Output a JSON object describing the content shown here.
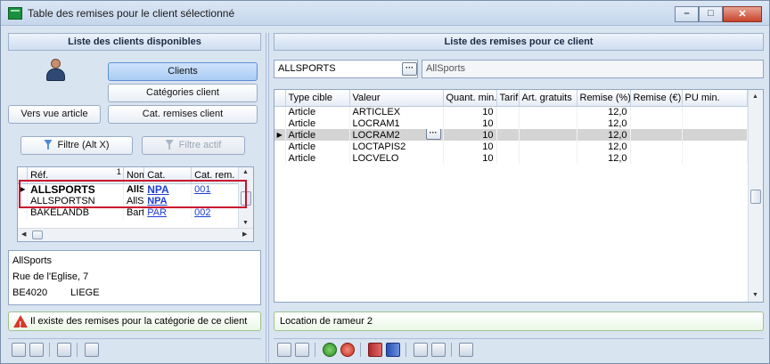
{
  "window": {
    "title": "Table des remises pour le client sélectionné",
    "minimize": "–",
    "maximize": "□",
    "close": "✕"
  },
  "left": {
    "header": "Liste des clients disponibles",
    "buttons": {
      "clients": "Clients",
      "categories": "Catégories client",
      "vers_vue": "Vers vue article",
      "cat_remises": "Cat. remises client",
      "filtre": "Filtre (Alt X)",
      "filtre_actif": "Filtre actif"
    },
    "grid": {
      "columns": [
        "Réf.",
        "Nom",
        "Cat.",
        "Cat. rem."
      ],
      "sort_mark": "1",
      "rows": [
        {
          "ref": "ALLSPORTS",
          "nom": "AllSp",
          "cat": "NPA",
          "catrem": "001",
          "selected": true
        },
        {
          "ref": "ALLSPORTSN",
          "nom": "AllSp",
          "cat": "NPA",
          "catrem": "",
          "selected": false
        },
        {
          "ref": "BAKELANDB",
          "nom": "Bart I",
          "cat": "PAR",
          "catrem": "002",
          "selected": false
        }
      ]
    },
    "address": {
      "name": "AllSports",
      "street": "Rue de l'Eglise, 7",
      "postcode": "BE4020",
      "city": "LIEGE"
    },
    "warning": "Il existe des remises pour la catégorie de ce client"
  },
  "right": {
    "header": "Liste des remises pour ce client",
    "client_code": "ALLSPORTS",
    "client_name": "AllSports",
    "ellipsis": "···",
    "grid": {
      "columns": [
        "Type cible",
        "Valeur",
        "Quant. min.",
        "Tarif",
        "Art. gratuits",
        "Remise (%)",
        "Remise (€)",
        "PU min."
      ],
      "rows": [
        {
          "type": "Article",
          "valeur": "ARTICLEX",
          "qmin": "10",
          "remise_pct": "12,0",
          "selected": false
        },
        {
          "type": "Article",
          "valeur": "LOCRAM1",
          "qmin": "10",
          "remise_pct": "12,0",
          "selected": false
        },
        {
          "type": "Article",
          "valeur": "LOCRAM2",
          "qmin": "10",
          "remise_pct": "12,0",
          "selected": true
        },
        {
          "type": "Article",
          "valeur": "LOCTAPIS2",
          "qmin": "10",
          "remise_pct": "12,0",
          "selected": false
        },
        {
          "type": "Article",
          "valeur": "LOCVELO",
          "qmin": "10",
          "remise_pct": "12,0",
          "selected": false
        }
      ]
    },
    "description": "Location de rameur 2"
  },
  "colors": {
    "accent": "#1f3fd1",
    "highlight_frame": "#c8102e",
    "selected_row": "#d4d4d4"
  }
}
